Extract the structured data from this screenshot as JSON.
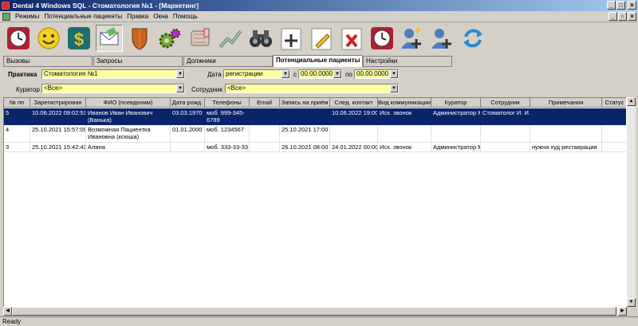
{
  "window": {
    "title": "Dental 4 Windows SQL - Стоматология №1 - [Маркетинг]"
  },
  "menu": [
    "Режимы",
    "Потенциальные пациенты",
    "Правка",
    "Окна",
    "Помощь"
  ],
  "toolbar": [
    {
      "icon": "clock-icon"
    },
    {
      "icon": "smiley-icon"
    },
    {
      "icon": "dollar-icon"
    },
    {
      "icon": "envelope-icon",
      "pressed": true
    },
    {
      "icon": "shield-icon"
    },
    {
      "icon": "gears-icon"
    },
    {
      "icon": "tooth-icon"
    },
    {
      "icon": "chart-icon"
    },
    {
      "icon": "binoculars-icon"
    },
    {
      "icon": "add-icon"
    },
    {
      "icon": "edit-pencil-icon"
    },
    {
      "icon": "delete-icon"
    },
    {
      "icon": "clock-icon"
    },
    {
      "icon": "add-group-icon"
    },
    {
      "icon": "add-user-icon"
    },
    {
      "icon": "refresh-icon"
    }
  ],
  "tabs": [
    "Вызовы",
    "Запросы",
    "Должники",
    "Потенциальные пациенты",
    "Настройки"
  ],
  "filters": {
    "practice_label": "Практика",
    "practice_value": "Стоматология №1",
    "date_label": "Дата",
    "date_type": "регистрации",
    "from_label": "с",
    "from_value": "00.00.0000",
    "to_label": "по",
    "to_value": "00.00.0000",
    "curator_label": "Куратор",
    "curator_value": "<Все>",
    "employee_label": "Сотрудник",
    "employee_value": "<Все>"
  },
  "grid": {
    "columns": [
      "№ пп",
      "Зарегистрирован",
      "ФИО (псевдоним)",
      "Дата рожд.",
      "Телефоны",
      "Email",
      "Запись на приём",
      "След. контакт",
      "Вид коммуникации",
      "Куратор",
      "Сотрудник",
      "Примечания",
      "Статус"
    ],
    "rows": [
      {
        "cells": [
          "5",
          "10.06.2022 09:02:51",
          "Иванов Иван Иванович (Ванька)",
          "03.03.1970",
          "моб. 999-345-6789",
          "",
          "",
          "10.06.2022 19:00",
          "Исх. звонок",
          "Администратор М",
          "Стоматолог И. И.",
          "",
          ""
        ],
        "selected": true
      },
      {
        "cells": [
          "4",
          "25.10.2021 15:57:09",
          "Возможная Пациентка Ивановна (ксюша)",
          "01.01.2000",
          "моб. 1234567",
          "",
          "25.10.2021 17:00",
          "",
          "",
          "",
          "",
          "",
          ""
        ]
      },
      {
        "cells": [
          "3",
          "25.10.2021 15:42:43",
          "Алина",
          "",
          "моб. 333-33-33",
          "",
          "26.10.2021 08:00",
          "24.01.2022 00:00",
          "Исх. звонок",
          "Администратор М",
          "",
          "нужна худ реставрация",
          ""
        ]
      }
    ]
  },
  "status": "Ready"
}
